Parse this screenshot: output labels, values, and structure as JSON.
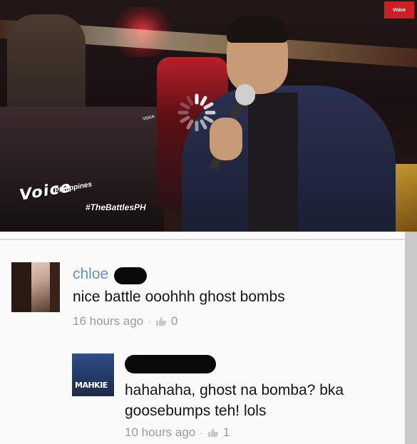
{
  "video": {
    "logo_main": "Voice",
    "logo_sub": "Philippines",
    "hashtag": "#TheBattlesPH",
    "corner_badge": "Voice",
    "camera_label": "Voice",
    "loading": true
  },
  "comments": [
    {
      "author": "chloe",
      "text": "nice battle ooohhh ghost bombs",
      "time": "16 hours ago",
      "likes": "0"
    },
    {
      "author": "",
      "avatar_text": "MAHKIE",
      "text": "hahahaha, ghost na bomba? bka goosebumps teh! lols",
      "time": "10 hours ago",
      "likes": "1"
    }
  ],
  "colors": {
    "author_link": "#6a8fc1",
    "meta_text": "#9a9a9a"
  },
  "icons": [
    "loading-spinner-icon",
    "thumbs-up-icon"
  ]
}
